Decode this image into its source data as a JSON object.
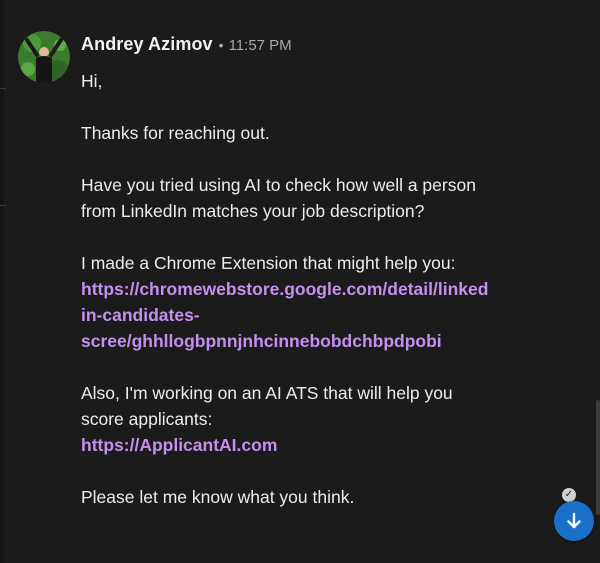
{
  "message": {
    "sender": "Andrey Azimov",
    "separator": "•",
    "time": "11:57 PM",
    "avatar_icon": "person-avatar-icon",
    "body": {
      "greeting": "Hi,",
      "thanks": "Thanks for reaching out.",
      "question_line1": "Have you tried using AI to check how well a person",
      "question_line2": "from LinkedIn matches your job description?",
      "extension_intro": "I made a Chrome Extension that might help you:",
      "extension_link_line1": "https://chromewebstore.google.com/detail/linked",
      "extension_link_line2": "in-candidates-",
      "extension_link_line3": "scree/ghhllogbpnnjnhcinnebobdchbpdpobi",
      "ats_line1": "Also, I'm working on an AI ATS that will help you",
      "ats_line2": "score applicants:",
      "ats_link": "https://ApplicantAI.com",
      "closing": "Please let me know what you think."
    }
  },
  "read_receipt_icon": "checkmark-icon",
  "scroll_button_icon": "arrow-down-icon",
  "colors": {
    "background": "#1b1b1b",
    "link": "#c490f0",
    "scroll_button": "#1a6fc9"
  }
}
